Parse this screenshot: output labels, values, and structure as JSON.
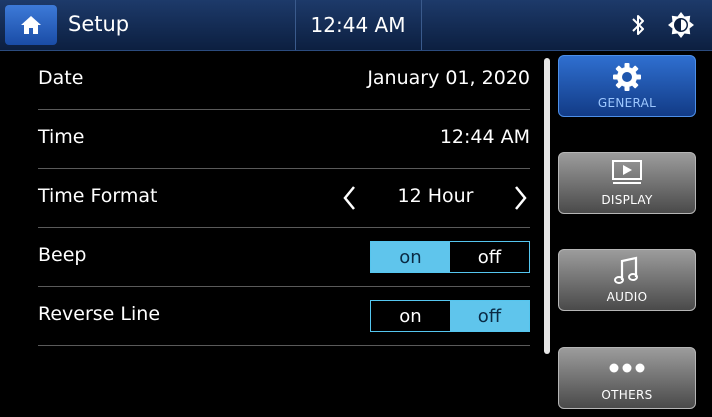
{
  "topbar": {
    "title": "Setup",
    "time": "12:44 AM"
  },
  "rows": {
    "date": {
      "label": "Date",
      "value": "January 01, 2020"
    },
    "time": {
      "label": "Time",
      "value": "12:44 AM"
    },
    "time_format": {
      "label": "Time Format",
      "value": "12 Hour"
    },
    "beep": {
      "label": "Beep",
      "on": "on",
      "off": "off",
      "selected": "on"
    },
    "reverse_line": {
      "label": "Reverse Line",
      "on": "on",
      "off": "off",
      "selected": "off"
    }
  },
  "tabs": {
    "general": "GENERAL",
    "display": "DISPLAY",
    "audio": "AUDIO",
    "others": "OTHERS"
  },
  "colors": {
    "accent": "#5fc5ec",
    "topbar": "#1d3a6a",
    "active_tab": "#2f6fd0"
  },
  "icons": {
    "home": "home-icon",
    "bluetooth": "bluetooth-icon",
    "brightness": "brightness-icon",
    "general": "gear-icon",
    "display": "play-screen-icon",
    "audio": "music-note-icon",
    "others": "more-dots-icon"
  }
}
